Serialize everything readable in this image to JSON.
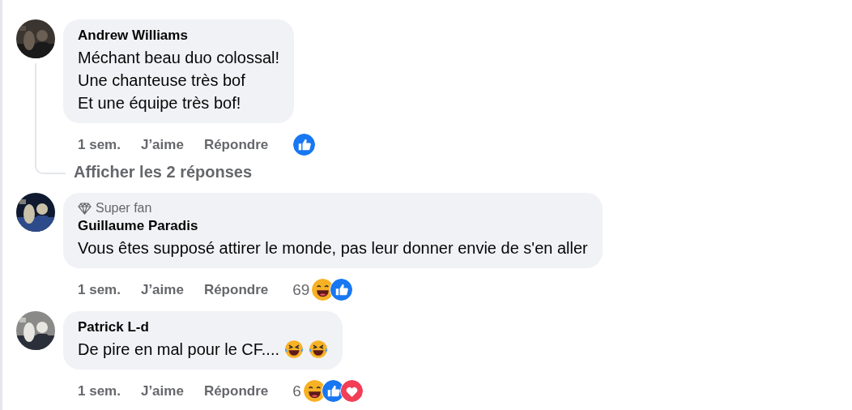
{
  "comments": [
    {
      "name": "Andrew Williams",
      "text": "Méchant beau duo colossal!\nUne chanteuse très bof\nEt une équipe très bof!",
      "time": "1 sem.",
      "like": "J’aime",
      "reply": "Répondre",
      "reactions": [
        {
          "kind": "like"
        }
      ],
      "replies_link": "Afficher les 2 réponses"
    },
    {
      "badge": "Super fan",
      "name": "Guillaume Paradis",
      "text": "Vous êtes supposé attirer le monde, pas leur donner envie de s'en aller",
      "time": "1 sem.",
      "like": "J’aime",
      "reply": "Répondre",
      "reaction_count": "69",
      "reactions": [
        {
          "kind": "haha"
        },
        {
          "kind": "like"
        }
      ]
    },
    {
      "name": "Patrick L-d",
      "text": "De pire en mal pour le CF....",
      "inline_emojis": [
        {
          "kind": "rofl"
        },
        {
          "kind": "rofl"
        }
      ],
      "time": "1 sem.",
      "like": "J’aime",
      "reply": "Répondre",
      "reaction_count": "6",
      "reactions": [
        {
          "kind": "haha"
        },
        {
          "kind": "like"
        },
        {
          "kind": "love"
        }
      ]
    }
  ]
}
